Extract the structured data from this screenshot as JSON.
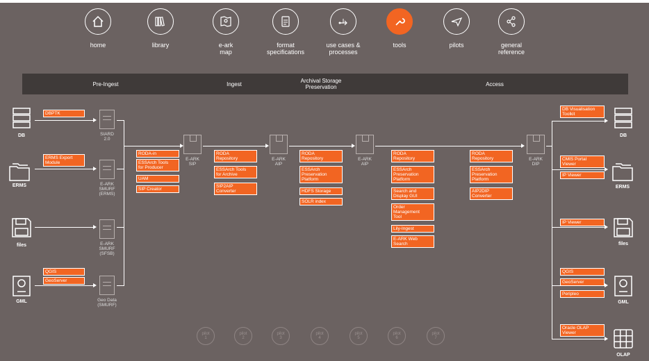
{
  "nav": [
    {
      "label": "home",
      "icon": "home-icon",
      "active": false
    },
    {
      "label": "library",
      "icon": "library-icon",
      "active": false
    },
    {
      "label": "e-ark\nmap",
      "icon": "map-icon",
      "active": false
    },
    {
      "label": "format\nspecifications",
      "icon": "document-icon",
      "active": false
    },
    {
      "label": "use cases &\nprocesses",
      "icon": "process-icon",
      "active": false
    },
    {
      "label": "tools",
      "icon": "wrench-icon",
      "active": true
    },
    {
      "label": "pilots",
      "icon": "paper-plane-icon",
      "active": false
    },
    {
      "label": "general\nreference",
      "icon": "share-icon",
      "active": false
    }
  ],
  "phases": [
    "Pre-Ingest",
    "Ingest",
    "Archival Storage\nPreservation",
    "Access"
  ],
  "sources": [
    {
      "label": "DB",
      "icon": "database-icon"
    },
    {
      "label": "ERMS",
      "icon": "folders-icon"
    },
    {
      "label": "files",
      "icon": "floppy-icon"
    },
    {
      "label": "GML",
      "icon": "map-pin-icon"
    }
  ],
  "targets": [
    {
      "label": "DB",
      "icon": "database-icon"
    },
    {
      "label": "ERMS",
      "icon": "folders-icon"
    },
    {
      "label": "files",
      "icon": "floppy-icon"
    },
    {
      "label": "GML",
      "icon": "map-pin-icon"
    },
    {
      "label": "OLAP",
      "icon": "grid-icon"
    }
  ],
  "source_tools": [
    "DBPTK",
    "ERMS Export\nModule",
    "QGIS",
    "GeoServer"
  ],
  "formats": [
    "SIARD\n2.0",
    "E-ARK\nSMURF\n(ERMS)",
    "E-ARK\nSMURF\n(SFSB)",
    "Geo Data\n(SMURF)"
  ],
  "packages": [
    "E-ARK\nSIP",
    "E-ARK\nAIP",
    "E-ARK\nAIP",
    "E-ARK\nDIP"
  ],
  "sip_tools": [
    "RODA-in",
    "ESSArch Tools\nfor Producer",
    "UAM",
    "SIP Creator"
  ],
  "ingest_tools": [
    "RODA\nRepository",
    "ESSArch Tools\nfor Archive",
    "SIP2AIP\nConverter"
  ],
  "storage_tools": [
    "RODA\nRepository",
    "ESSArch\nPreservation\nPlatform",
    "HDFS Storage",
    "SOLR index"
  ],
  "search_tools": [
    "RODA\nRepository",
    "ESSArch\nPreservation\nPlatform",
    "Search and\nDisplay GUI",
    "Order\nManagement\nTool",
    "Lily-Ingest",
    "E-ARK Web\nSearch"
  ],
  "access_tools": [
    "RODA\nRepository",
    "ESSArch\nPreservation\nPlatform",
    "AIP2DIP\nConverter"
  ],
  "viewer_tools": [
    "DB Visualisation\nToolkit",
    "CMIS Portal\nViewer",
    "IP Viewer",
    "IP Viewer",
    "QGIS",
    "GeoServer",
    "Peripleo",
    "Oracle OLAP\nViewer"
  ],
  "pilots": [
    "pilot\n1",
    "pilot\n2",
    "pilot\n3",
    "pilot\n4",
    "pilot\n5",
    "pilot\n6",
    "pilot\n7"
  ],
  "colors": {
    "background": "#6b6261",
    "accent": "#f26522",
    "bar": "#3f3a39"
  }
}
